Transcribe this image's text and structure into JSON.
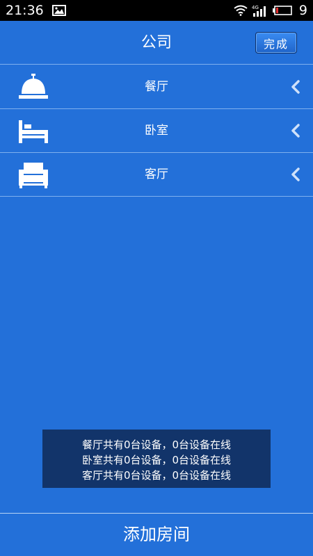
{
  "status_bar": {
    "time": "21:36",
    "network": "4G",
    "battery": "9",
    "icons": [
      "gallery-icon",
      "wifi-icon",
      "signal-icon",
      "battery-icon"
    ]
  },
  "header": {
    "title": "公司",
    "done_label": "完成"
  },
  "rooms": [
    {
      "label": "餐厅",
      "icon": "dining-bell-icon"
    },
    {
      "label": "卧室",
      "icon": "bed-icon"
    },
    {
      "label": "客厅",
      "icon": "sofa-icon"
    }
  ],
  "summary": {
    "lines": [
      "餐厅共有0台设备，0台设备在线",
      "卧室共有0台设备，0台设备在线",
      "客厅共有0台设备，0台设备在线"
    ]
  },
  "footer": {
    "add_room_label": "添加房间"
  },
  "colors": {
    "background": "#2370d9",
    "summary_background": "#12346a",
    "status_bar": "#000000",
    "text": "#ffffff"
  }
}
